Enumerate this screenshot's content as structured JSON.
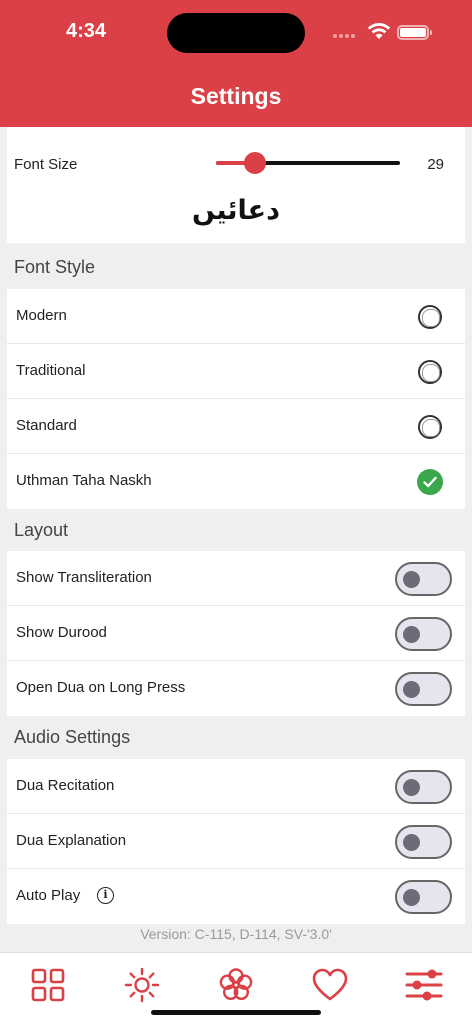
{
  "status_bar": {
    "time": "4:34"
  },
  "header": {
    "title": "Settings"
  },
  "font_size": {
    "label": "Font Size",
    "value": "29",
    "min": 10,
    "max": 100,
    "current": 29,
    "sample_text": "دعائیں"
  },
  "font_style": {
    "title": "Font Style",
    "options": [
      {
        "label": "Modern",
        "selected": false
      },
      {
        "label": "Traditional",
        "selected": false
      },
      {
        "label": "Standard",
        "selected": false
      },
      {
        "label": "Uthman Taha Naskh",
        "selected": true
      }
    ]
  },
  "layout": {
    "title": "Layout",
    "items": [
      {
        "label": "Show Transliteration",
        "on": false
      },
      {
        "label": "Show Durood",
        "on": false
      },
      {
        "label": "Open Dua on Long Press",
        "on": false
      }
    ]
  },
  "audio": {
    "title": "Audio Settings",
    "items": [
      {
        "label": "Dua Recitation",
        "on": false
      },
      {
        "label": "Dua Explanation",
        "on": false
      },
      {
        "label": "Auto Play",
        "on": false,
        "info_icon": "info-icon"
      }
    ]
  },
  "version_text": "Version: C-115, D-114, SV-'3.0'",
  "tabs": [
    {
      "icon": "grid-icon",
      "active": false
    },
    {
      "icon": "sun-icon",
      "active": false
    },
    {
      "icon": "flower-icon",
      "active": false
    },
    {
      "icon": "heart-icon",
      "active": false
    },
    {
      "icon": "sliders-icon",
      "active": true
    }
  ],
  "colors": {
    "brand": "#db4046",
    "check": "#3aa84a",
    "toggle_off": "#e8e4ef"
  }
}
